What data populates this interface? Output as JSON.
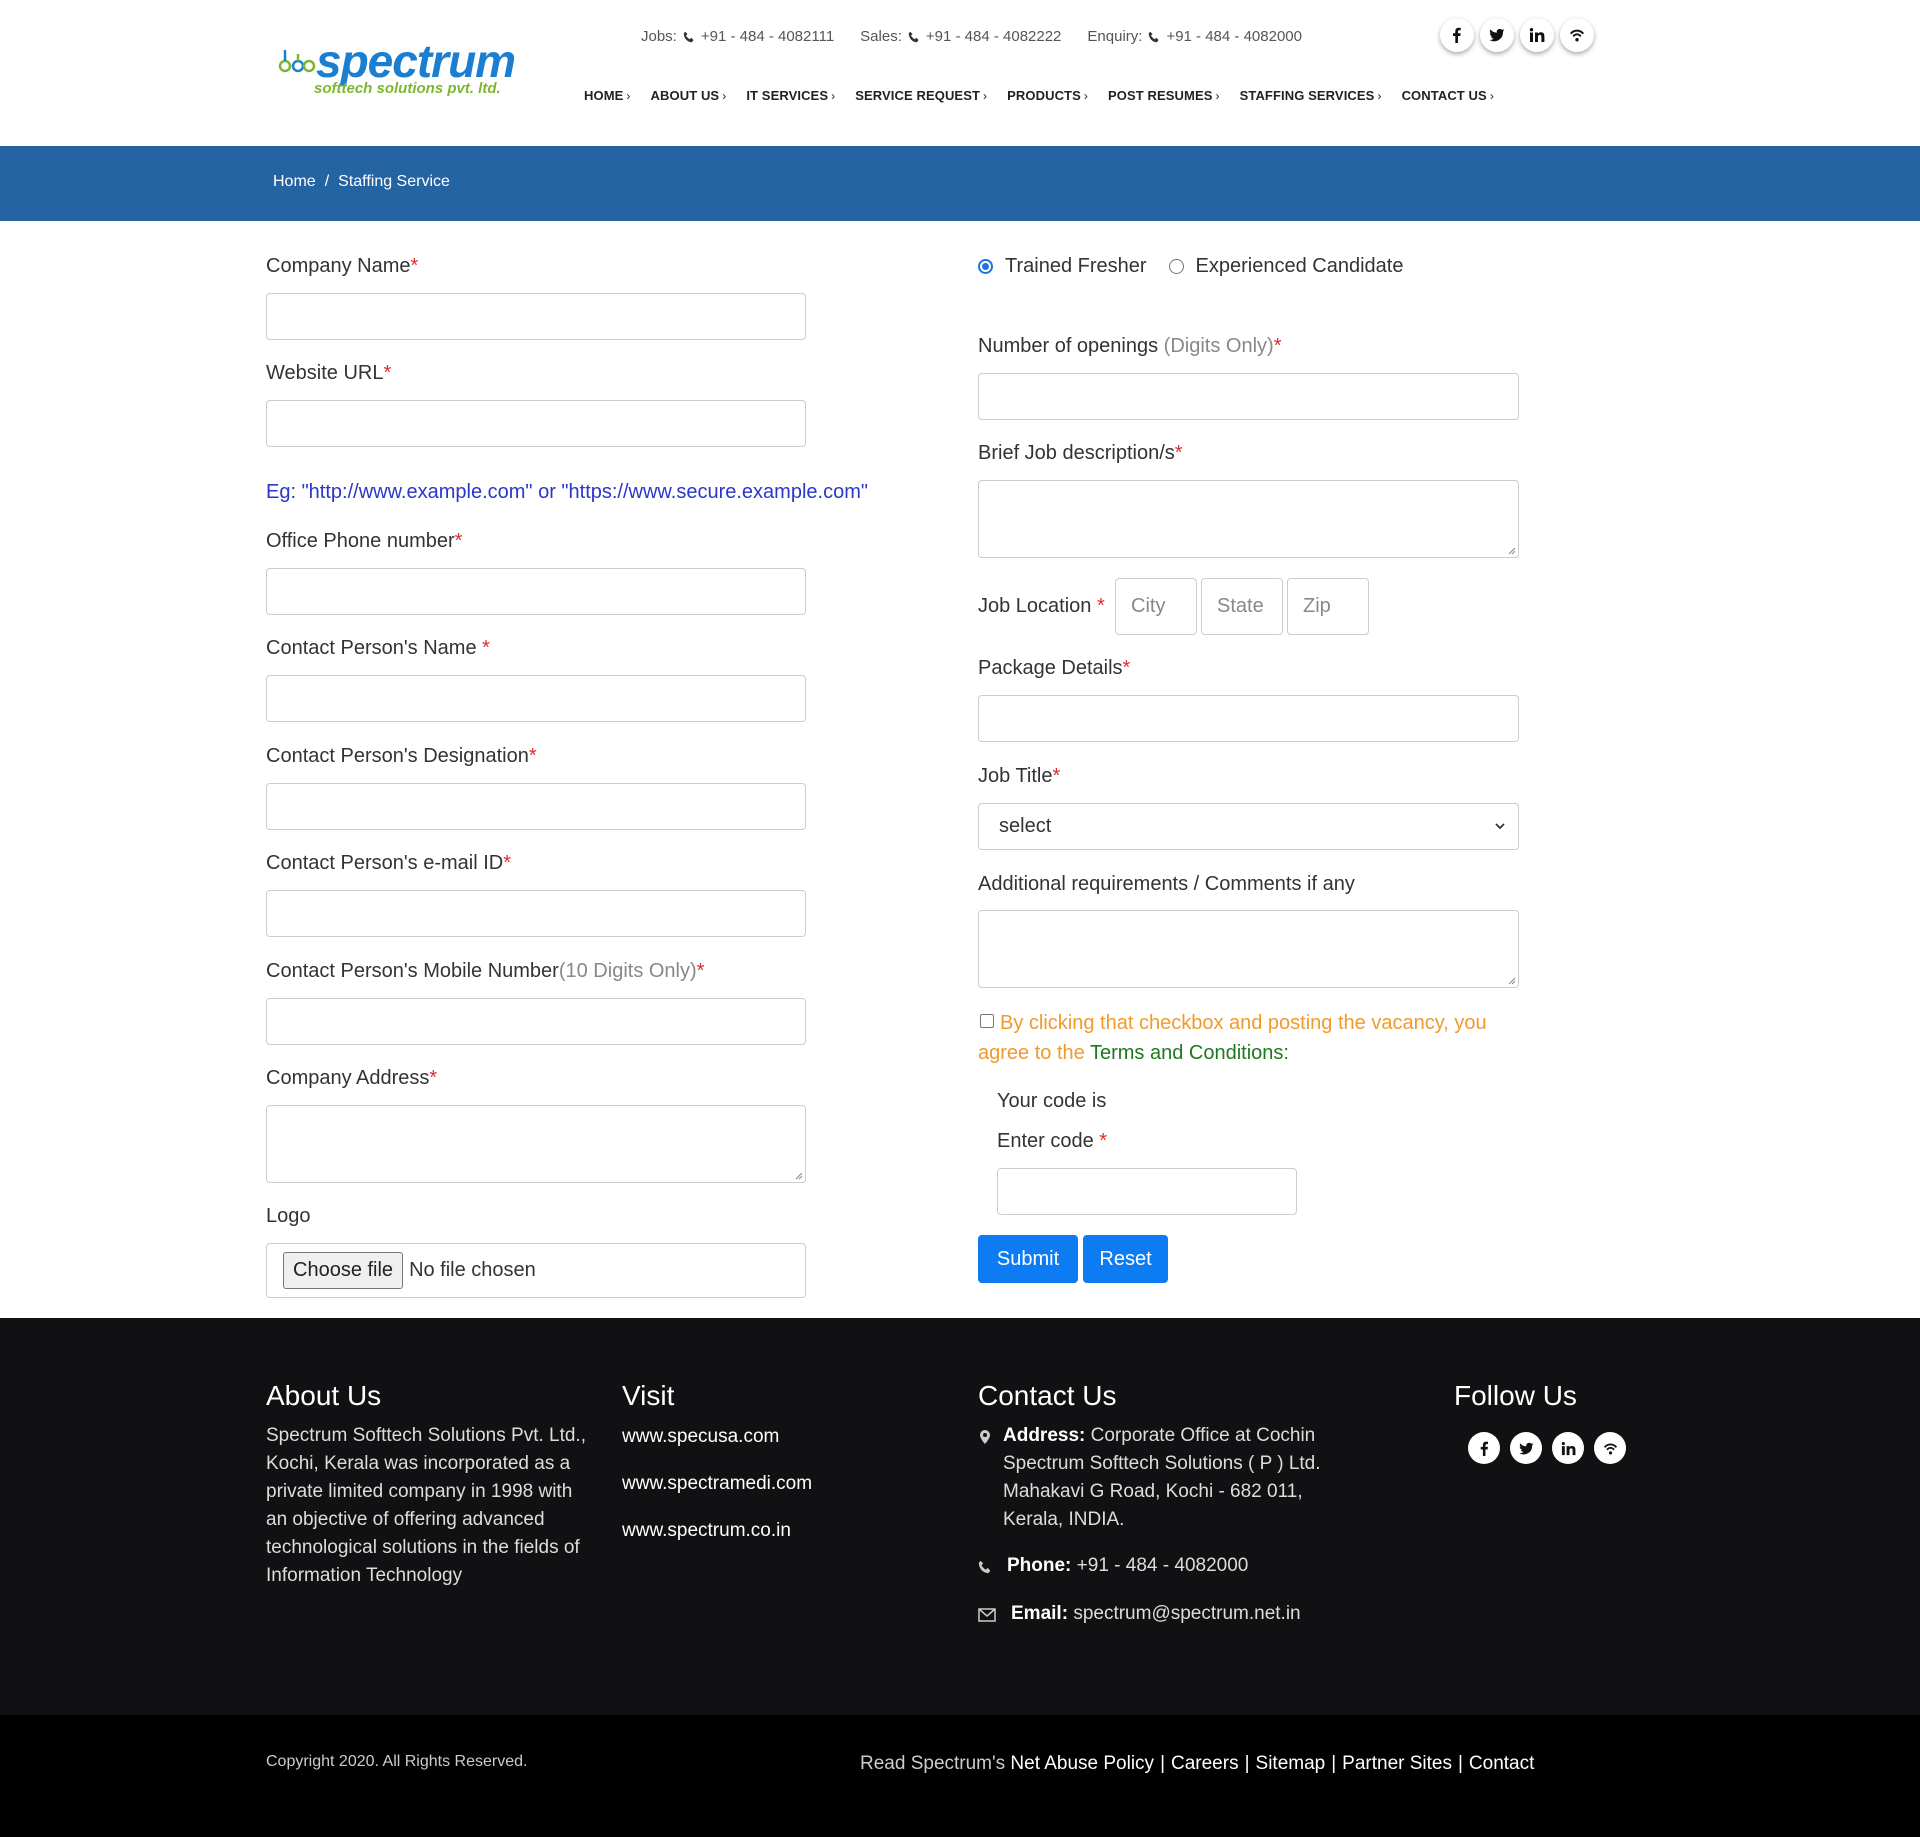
{
  "brand": {
    "name": "spectrum",
    "tagline": "softtech solutions pvt. ltd.",
    "blue": "#1b7fd1",
    "green": "#7cb82f"
  },
  "contacts": [
    {
      "label": "Jobs:",
      "number": "+91 - 484 - 4082111"
    },
    {
      "label": "Sales:",
      "number": "+91 - 484 - 4082222"
    },
    {
      "label": "Enquiry:",
      "number": "+91 - 484 - 4082000"
    }
  ],
  "social_icons": [
    "facebook-icon",
    "twitter-icon",
    "linkedin-icon",
    "rss-icon"
  ],
  "nav": [
    "HOME",
    "ABOUT US",
    "IT SERVICES",
    "SERVICE REQUEST",
    "PRODUCTS",
    "POST RESUMES",
    "STAFFING SERVICES",
    "CONTACT US"
  ],
  "breadcrumb": {
    "home": "Home",
    "separator": "/",
    "current": "Staffing Service",
    "bar_color": "#2564a3"
  },
  "form_left": {
    "company_name": "Company Name",
    "website_url": "Website URL",
    "url_hint": "Eg: \"http://www.example.com\" or \"https://www.secure.example.com\"",
    "office_phone": "Office Phone number",
    "contact_name": "Contact Person's Name ",
    "contact_designation": "Contact Person's Designation",
    "contact_email": "Contact Person's e-mail ID",
    "contact_mobile": "Contact Person's Mobile Number",
    "contact_mobile_hint": "(10 Digits Only)",
    "company_address": "Company Address",
    "logo": "Logo",
    "file_button": "Choose file",
    "file_status": "No file chosen",
    "required_mark": "*"
  },
  "form_right": {
    "radio_fresher": "Trained Fresher",
    "radio_experienced": "Experienced Candidate",
    "selected_radio": "Trained Fresher",
    "openings": "Number of openings ",
    "openings_hint": "(Digits Only)",
    "job_description": "Brief Job description/s",
    "job_location": "Job Location ",
    "city_placeholder": "City",
    "state_placeholder": "State",
    "zip_placeholder": "Zip",
    "package": "Package Details",
    "job_title": "Job Title",
    "job_title_selected": "select",
    "comments": "Additional requirements / Comments if any",
    "agree_text": "By clicking that checkbox and posting the vacancy, you agree to the ",
    "terms_link": "Terms and Conditions:",
    "code_label": "Your code is",
    "enter_code": "Enter code ",
    "submit": "Submit",
    "reset": "Reset",
    "accent": "#0d7cf2"
  },
  "footer": {
    "about_title": "About Us",
    "about_text": "Spectrum Softtech Solutions Pvt. Ltd., Kochi, Kerala was incorporated as a private limited company in 1998 with an objective of offering advanced technological solutions in the fields of Information Technology",
    "visit_title": "Visit",
    "visit_links": [
      "www.specusa.com",
      "www.spectramedi.com",
      "www.spectrum.co.in"
    ],
    "contact_title": "Contact Us",
    "address_label": "Address:",
    "address_lines": [
      "Corporate Office at Cochin",
      "Spectrum Softtech Solutions ( P ) Ltd.",
      "Mahakavi G Road, Kochi - 682 011,",
      "Kerala, INDIA."
    ],
    "phone_label": "Phone:",
    "phone": "+91 - 484 - 4082000",
    "email_label": "Email:",
    "email": "spectrum@spectrum.net.in",
    "follow_title": "Follow Us"
  },
  "bottom": {
    "copyright": "Copyright 2020. All Rights Reserved.",
    "read_prefix": "Read Spectrum's ",
    "links": [
      "Net Abuse Policy",
      "Careers",
      "Sitemap",
      "Partner Sites",
      "Contact"
    ],
    "separator": "|"
  }
}
